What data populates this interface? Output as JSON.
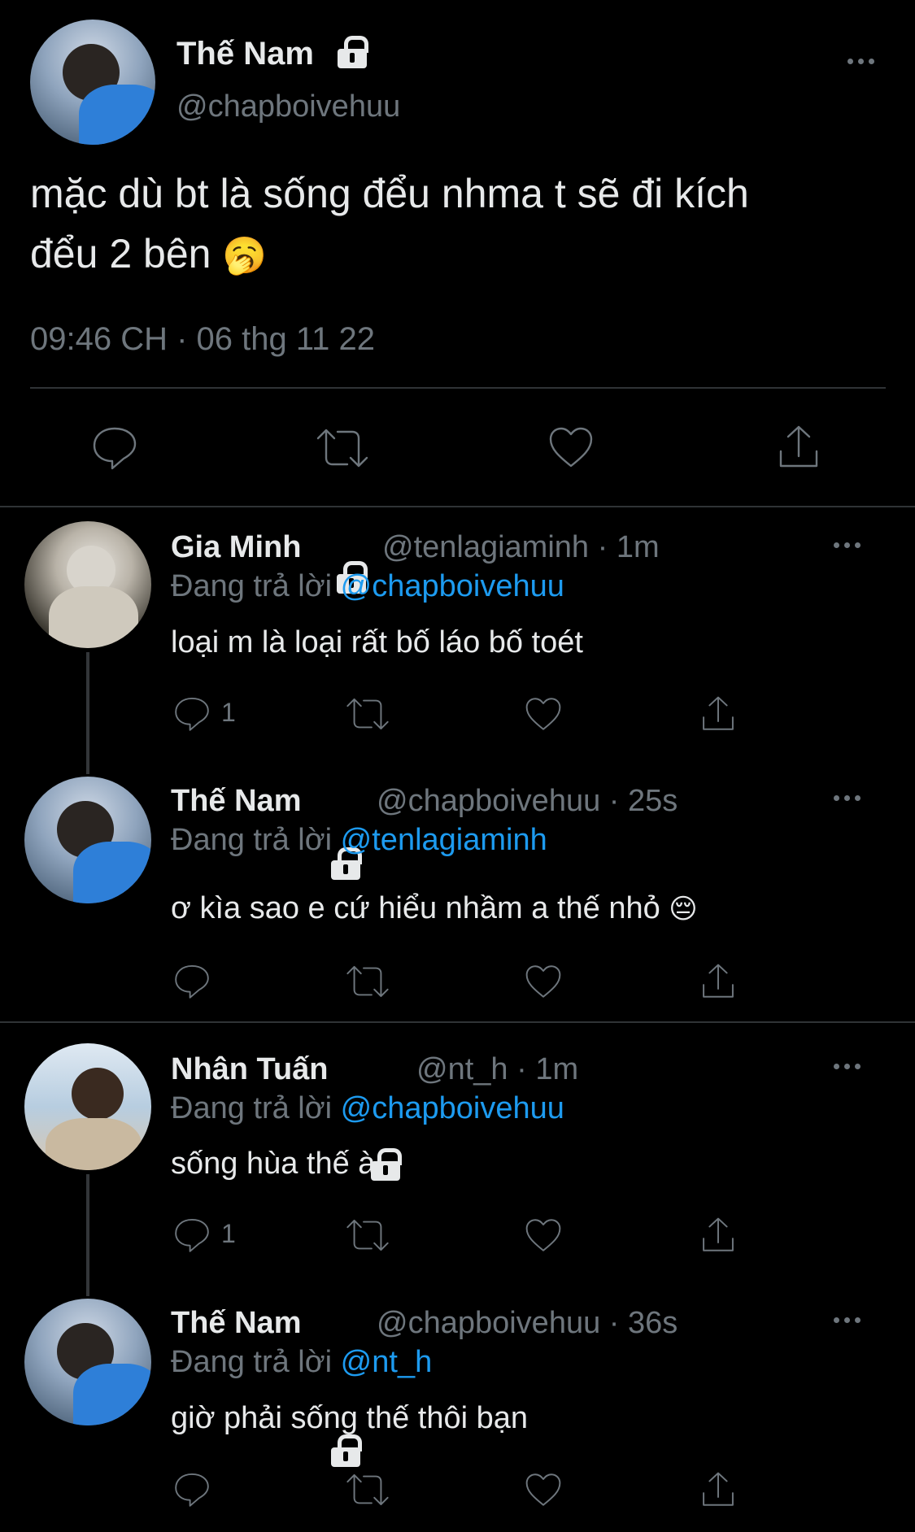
{
  "main_tweet": {
    "display_name": "Thế Nam",
    "handle": "@chapboivehuu",
    "text_line1": "mặc dù bt là sống đểu nhma t sẽ đi kích",
    "text_line2": "đểu 2 bên",
    "emoji": "🥱",
    "timestamp": "09:46 CH · 06 thg 11 22"
  },
  "replies": [
    {
      "display_name": "Gia Minh",
      "handle": "@tenlagiaminh",
      "time": "· 1m",
      "replying_prefix": "Đang trả lời",
      "replying_to": "@chapboivehuu",
      "text": "loại m là loại rất bố láo bố toét",
      "reply_count": "1"
    },
    {
      "display_name": "Thế Nam",
      "handle": "@chapboivehuu",
      "time": "· 25s",
      "replying_prefix": "Đang trả lời",
      "replying_to": "@tenlagiaminh",
      "text": "ơ kìa sao e cứ hiểu nhầm a thế nhỏ",
      "emoji": "😔",
      "reply_count": ""
    },
    {
      "display_name": "Nhân Tuấn",
      "handle": "@nt_h",
      "time": "· 1m",
      "replying_prefix": "Đang trả lời",
      "replying_to": "@chapboivehuu",
      "text": "sống hùa thế à",
      "reply_count": "1"
    },
    {
      "display_name": "Thế Nam",
      "handle": "@chapboivehuu",
      "time": "· 36s",
      "replying_prefix": "Đang trả lời",
      "replying_to": "@nt_h",
      "text": "giờ phải sống thế thôi bạn",
      "reply_count": ""
    }
  ],
  "colors": {
    "background": "#000000",
    "text": "#e7e9ea",
    "secondary": "#6e767d",
    "mention": "#1d9bf0"
  },
  "icons": [
    "reply-icon",
    "retweet-icon",
    "like-icon",
    "share-icon",
    "lock-icon",
    "more-icon"
  ]
}
